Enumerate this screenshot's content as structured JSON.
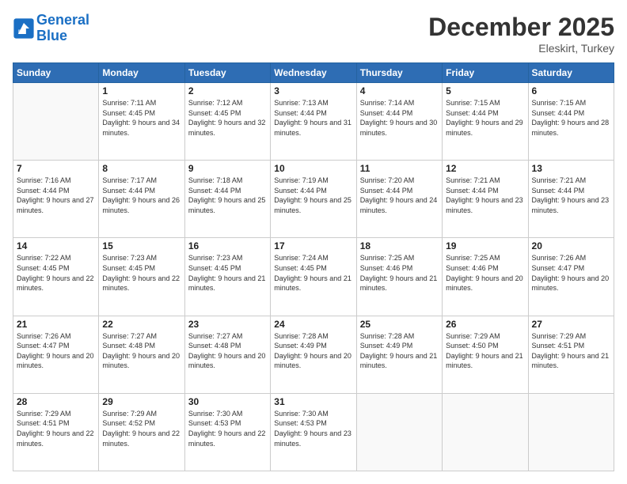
{
  "header": {
    "logo_line1": "General",
    "logo_line2": "Blue",
    "month": "December 2025",
    "location": "Eleskirt, Turkey"
  },
  "weekdays": [
    "Sunday",
    "Monday",
    "Tuesday",
    "Wednesday",
    "Thursday",
    "Friday",
    "Saturday"
  ],
  "weeks": [
    [
      {
        "day": "",
        "sunrise": "",
        "sunset": "",
        "daylight": ""
      },
      {
        "day": "1",
        "sunrise": "Sunrise: 7:11 AM",
        "sunset": "Sunset: 4:45 PM",
        "daylight": "Daylight: 9 hours and 34 minutes."
      },
      {
        "day": "2",
        "sunrise": "Sunrise: 7:12 AM",
        "sunset": "Sunset: 4:45 PM",
        "daylight": "Daylight: 9 hours and 32 minutes."
      },
      {
        "day": "3",
        "sunrise": "Sunrise: 7:13 AM",
        "sunset": "Sunset: 4:44 PM",
        "daylight": "Daylight: 9 hours and 31 minutes."
      },
      {
        "day": "4",
        "sunrise": "Sunrise: 7:14 AM",
        "sunset": "Sunset: 4:44 PM",
        "daylight": "Daylight: 9 hours and 30 minutes."
      },
      {
        "day": "5",
        "sunrise": "Sunrise: 7:15 AM",
        "sunset": "Sunset: 4:44 PM",
        "daylight": "Daylight: 9 hours and 29 minutes."
      },
      {
        "day": "6",
        "sunrise": "Sunrise: 7:15 AM",
        "sunset": "Sunset: 4:44 PM",
        "daylight": "Daylight: 9 hours and 28 minutes."
      }
    ],
    [
      {
        "day": "7",
        "sunrise": "Sunrise: 7:16 AM",
        "sunset": "Sunset: 4:44 PM",
        "daylight": "Daylight: 9 hours and 27 minutes."
      },
      {
        "day": "8",
        "sunrise": "Sunrise: 7:17 AM",
        "sunset": "Sunset: 4:44 PM",
        "daylight": "Daylight: 9 hours and 26 minutes."
      },
      {
        "day": "9",
        "sunrise": "Sunrise: 7:18 AM",
        "sunset": "Sunset: 4:44 PM",
        "daylight": "Daylight: 9 hours and 25 minutes."
      },
      {
        "day": "10",
        "sunrise": "Sunrise: 7:19 AM",
        "sunset": "Sunset: 4:44 PM",
        "daylight": "Daylight: 9 hours and 25 minutes."
      },
      {
        "day": "11",
        "sunrise": "Sunrise: 7:20 AM",
        "sunset": "Sunset: 4:44 PM",
        "daylight": "Daylight: 9 hours and 24 minutes."
      },
      {
        "day": "12",
        "sunrise": "Sunrise: 7:21 AM",
        "sunset": "Sunset: 4:44 PM",
        "daylight": "Daylight: 9 hours and 23 minutes."
      },
      {
        "day": "13",
        "sunrise": "Sunrise: 7:21 AM",
        "sunset": "Sunset: 4:44 PM",
        "daylight": "Daylight: 9 hours and 23 minutes."
      }
    ],
    [
      {
        "day": "14",
        "sunrise": "Sunrise: 7:22 AM",
        "sunset": "Sunset: 4:45 PM",
        "daylight": "Daylight: 9 hours and 22 minutes."
      },
      {
        "day": "15",
        "sunrise": "Sunrise: 7:23 AM",
        "sunset": "Sunset: 4:45 PM",
        "daylight": "Daylight: 9 hours and 22 minutes."
      },
      {
        "day": "16",
        "sunrise": "Sunrise: 7:23 AM",
        "sunset": "Sunset: 4:45 PM",
        "daylight": "Daylight: 9 hours and 21 minutes."
      },
      {
        "day": "17",
        "sunrise": "Sunrise: 7:24 AM",
        "sunset": "Sunset: 4:45 PM",
        "daylight": "Daylight: 9 hours and 21 minutes."
      },
      {
        "day": "18",
        "sunrise": "Sunrise: 7:25 AM",
        "sunset": "Sunset: 4:46 PM",
        "daylight": "Daylight: 9 hours and 21 minutes."
      },
      {
        "day": "19",
        "sunrise": "Sunrise: 7:25 AM",
        "sunset": "Sunset: 4:46 PM",
        "daylight": "Daylight: 9 hours and 20 minutes."
      },
      {
        "day": "20",
        "sunrise": "Sunrise: 7:26 AM",
        "sunset": "Sunset: 4:47 PM",
        "daylight": "Daylight: 9 hours and 20 minutes."
      }
    ],
    [
      {
        "day": "21",
        "sunrise": "Sunrise: 7:26 AM",
        "sunset": "Sunset: 4:47 PM",
        "daylight": "Daylight: 9 hours and 20 minutes."
      },
      {
        "day": "22",
        "sunrise": "Sunrise: 7:27 AM",
        "sunset": "Sunset: 4:48 PM",
        "daylight": "Daylight: 9 hours and 20 minutes."
      },
      {
        "day": "23",
        "sunrise": "Sunrise: 7:27 AM",
        "sunset": "Sunset: 4:48 PM",
        "daylight": "Daylight: 9 hours and 20 minutes."
      },
      {
        "day": "24",
        "sunrise": "Sunrise: 7:28 AM",
        "sunset": "Sunset: 4:49 PM",
        "daylight": "Daylight: 9 hours and 20 minutes."
      },
      {
        "day": "25",
        "sunrise": "Sunrise: 7:28 AM",
        "sunset": "Sunset: 4:49 PM",
        "daylight": "Daylight: 9 hours and 21 minutes."
      },
      {
        "day": "26",
        "sunrise": "Sunrise: 7:29 AM",
        "sunset": "Sunset: 4:50 PM",
        "daylight": "Daylight: 9 hours and 21 minutes."
      },
      {
        "day": "27",
        "sunrise": "Sunrise: 7:29 AM",
        "sunset": "Sunset: 4:51 PM",
        "daylight": "Daylight: 9 hours and 21 minutes."
      }
    ],
    [
      {
        "day": "28",
        "sunrise": "Sunrise: 7:29 AM",
        "sunset": "Sunset: 4:51 PM",
        "daylight": "Daylight: 9 hours and 22 minutes."
      },
      {
        "day": "29",
        "sunrise": "Sunrise: 7:29 AM",
        "sunset": "Sunset: 4:52 PM",
        "daylight": "Daylight: 9 hours and 22 minutes."
      },
      {
        "day": "30",
        "sunrise": "Sunrise: 7:30 AM",
        "sunset": "Sunset: 4:53 PM",
        "daylight": "Daylight: 9 hours and 22 minutes."
      },
      {
        "day": "31",
        "sunrise": "Sunrise: 7:30 AM",
        "sunset": "Sunset: 4:53 PM",
        "daylight": "Daylight: 9 hours and 23 minutes."
      },
      {
        "day": "",
        "sunrise": "",
        "sunset": "",
        "daylight": ""
      },
      {
        "day": "",
        "sunrise": "",
        "sunset": "",
        "daylight": ""
      },
      {
        "day": "",
        "sunrise": "",
        "sunset": "",
        "daylight": ""
      }
    ]
  ]
}
